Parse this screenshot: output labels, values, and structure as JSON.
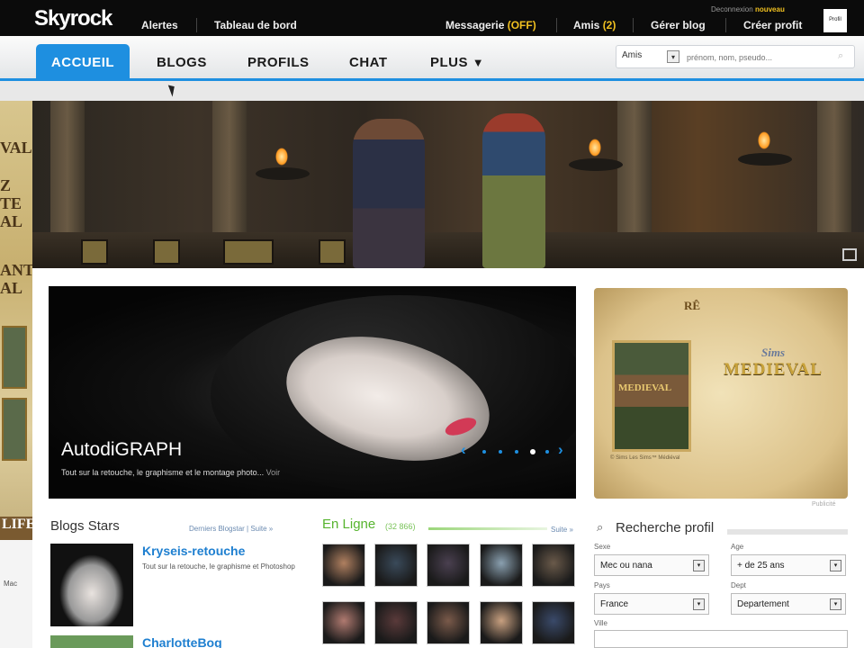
{
  "topbar": {
    "logo": "Skyrock",
    "deconnexion": "Deconnexion",
    "new_user_label": "nouveau",
    "avatar_label": "Profil",
    "links": {
      "alertes": "Alertes",
      "tableau": "Tableau de bord",
      "messagerie": "Messagerie",
      "messagerie_status": "(OFF)",
      "amis": "Amis",
      "amis_count": "(2)",
      "gerer_blog": "Gérer blog",
      "creer_profil": "Créer profit"
    }
  },
  "nav": {
    "items": [
      "ACCUEIL",
      "BLOGS",
      "PROFILS",
      "CHAT",
      "PLUS"
    ],
    "active": "ACCUEIL",
    "plus_arrow": "▼",
    "search": {
      "scope": "Amis",
      "placeholder": "prénom, nom, pseudo..."
    }
  },
  "left_ad": {
    "lines": [
      "VAL",
      "Z",
      "TE",
      "AL",
      "ANT",
      "AL",
      "LIFE",
      "Mac"
    ]
  },
  "feature": {
    "title": "AutodiGRAPH",
    "description": "Tout sur la retouche, le graphisme et le montage photo... ",
    "more": "Voir",
    "pager_prev": "‹",
    "pager_next": "›",
    "slide_count": 5,
    "active_slide": 4
  },
  "sims_ad": {
    "tag": "RÊ",
    "box_title": "MEDIEVAL",
    "brand": "Sims",
    "title": "MEDIEVAL",
    "fine_print": "© Sims Les Sims™ Médiéval",
    "pub_label": "Publicité"
  },
  "blogs_stars": {
    "title": "Blogs Stars",
    "links": "Derniers Blogstar | Suite »",
    "items": [
      {
        "name": "Kryseis-retouche",
        "description": "Tout sur la retouche, le graphisme et Photoshop"
      },
      {
        "name": "CharlotteBog",
        "description": ""
      }
    ]
  },
  "en_ligne": {
    "title": "En Ligne",
    "count": "(32 866)",
    "more": "Suite »",
    "member_colors": [
      "#b08060",
      "#3a4a5a",
      "#4a4050",
      "#8aa0b0",
      "#6a5a4a",
      "#b07a70",
      "#5a3a3a",
      "#7a5a4a",
      "#c8a080",
      "#3a4a6a"
    ]
  },
  "recherche": {
    "title": "Recherche profil",
    "fields": {
      "sexe": {
        "label": "Sexe",
        "value": "Mec ou nana"
      },
      "age": {
        "label": "Age",
        "value": "+ de 25 ans"
      },
      "pays": {
        "label": "Pays",
        "value": "France"
      },
      "dept": {
        "label": "Dept",
        "value": "Departement"
      },
      "ville": {
        "label": "Ville",
        "value": ""
      }
    }
  }
}
